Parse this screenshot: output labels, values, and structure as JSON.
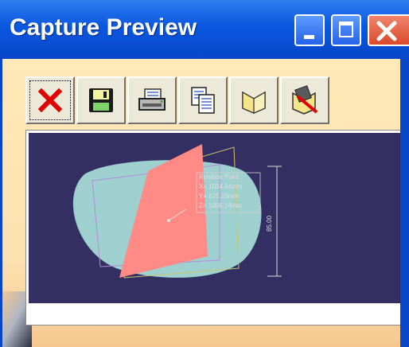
{
  "window": {
    "title": "Capture Preview",
    "controls": [
      "minimize",
      "maximize",
      "close"
    ]
  },
  "toolbar": {
    "buttons": [
      {
        "icon": "close-x-icon",
        "color": "#e00000"
      },
      {
        "icon": "save-floppy-icon"
      },
      {
        "icon": "printer-icon"
      },
      {
        "icon": "copy-icon"
      },
      {
        "icon": "album-icon"
      },
      {
        "icon": "album-delete-icon"
      }
    ]
  },
  "preview": {
    "background": "#332f63",
    "annotation": {
      "heading": "Rotation Point",
      "x": "X= 1004.84mm",
      "y": "Y= 675.25mm",
      "z": "Z= 1056.14mm",
      "dimension": "85.00"
    }
  }
}
